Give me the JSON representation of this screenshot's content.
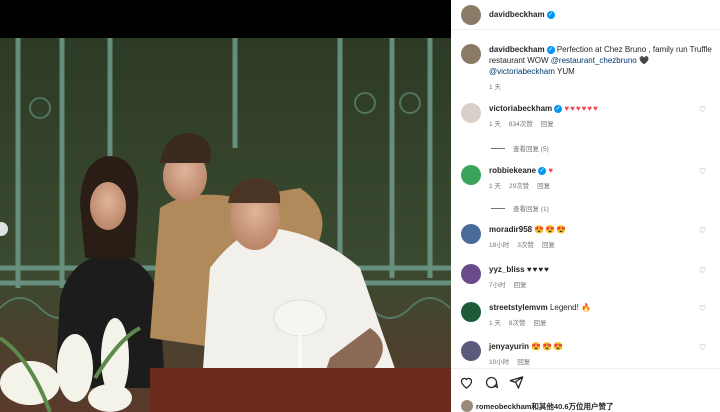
{
  "post": {
    "author": "davidbeckham",
    "caption_pre": "Perfection at Chez Bruno , family run Truffle restaurant WOW ",
    "mention1": "@restaurant_chezbruno",
    "heart": "🖤",
    "mention2": "@victoriabeckham",
    "caption_post": "YUM",
    "time": "1 天"
  },
  "comments": [
    {
      "user": "victoriabeckham",
      "verified": true,
      "text": "♥♥♥♥♥♥",
      "time": "1 天",
      "likes": "834次赞",
      "reply": "回复",
      "view_replies": "查看回复 (5)"
    },
    {
      "user": "robbiekeane",
      "verified": true,
      "text": "♥",
      "time": "1 天",
      "likes": "29次赞",
      "reply": "回复",
      "view_replies": "查看回复 (1)"
    },
    {
      "user": "moradir958",
      "verified": false,
      "text": "😍😍😍",
      "time": "18小时",
      "likes": "3次赞",
      "reply": "回复"
    },
    {
      "user": "yyz_bliss",
      "verified": false,
      "text": "♥♥♥♥",
      "time": "7小时",
      "likes": "",
      "reply": "回复"
    },
    {
      "user": "streetstylemvm",
      "verified": false,
      "text": "Legend! 🔥",
      "time": "1 天",
      "likes": "8次赞",
      "reply": "回复"
    },
    {
      "user": "jenyayurin",
      "verified": false,
      "text": "😍😍😍",
      "time": "10小时",
      "likes": "",
      "reply": "回复"
    }
  ],
  "likes": {
    "text": "romeobeckham和其他40.6万位用户赞了"
  },
  "colors": {
    "verified": "#0095f6",
    "heart": "#ed4956",
    "link": "#00376b"
  }
}
